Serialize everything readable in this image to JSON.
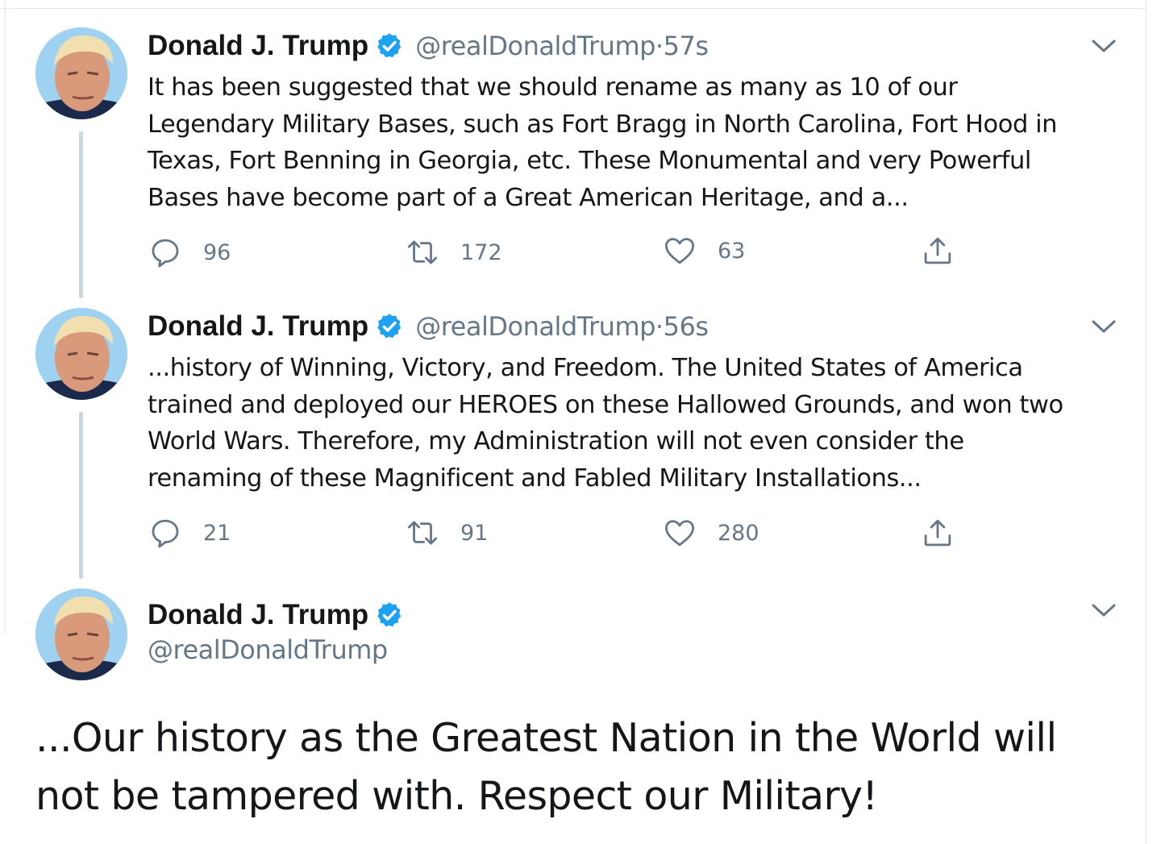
{
  "tweets": [
    {
      "name": "Donald J. Trump",
      "handle": "@realDonaldTrump",
      "separator": "·",
      "time": "57s",
      "text": "It has been suggested that we should rename as many as 10 of our\nLegendary Military Bases, such as Fort Bragg in North Carolina, Fort Hood in\nTexas, Fort Benning in Georgia, etc. These Monumental and very Powerful\nBases have become part of a Great American Heritage, and a...",
      "replies": "96",
      "retweets": "172",
      "likes": "63"
    },
    {
      "name": "Donald J. Trump",
      "handle": "@realDonaldTrump",
      "separator": "·",
      "time": "56s",
      "text": "...history of Winning, Victory, and Freedom. The United States of America\ntrained and deployed our HEROES on these Hallowed Grounds, and won two\nWorld Wars. Therefore, my Administration will not even consider the\nrenaming of these Magnificent and Fabled Military Installations...",
      "replies": "21",
      "retweets": "91",
      "likes": "280"
    },
    {
      "name": "Donald J. Trump",
      "handle": "@realDonaldTrump",
      "text": "...Our history as the Greatest Nation in the World will\nnot be tampered with. Respect our Military!"
    }
  ],
  "colors": {
    "verified": "#1da1f2",
    "secondary_text": "#657786",
    "thread_line": "#ccd6dd",
    "primary_text": "#14171a"
  },
  "icons": [
    "verified-badge-icon",
    "chevron-down-icon",
    "reply-icon",
    "retweet-icon",
    "like-icon",
    "share-icon"
  ]
}
